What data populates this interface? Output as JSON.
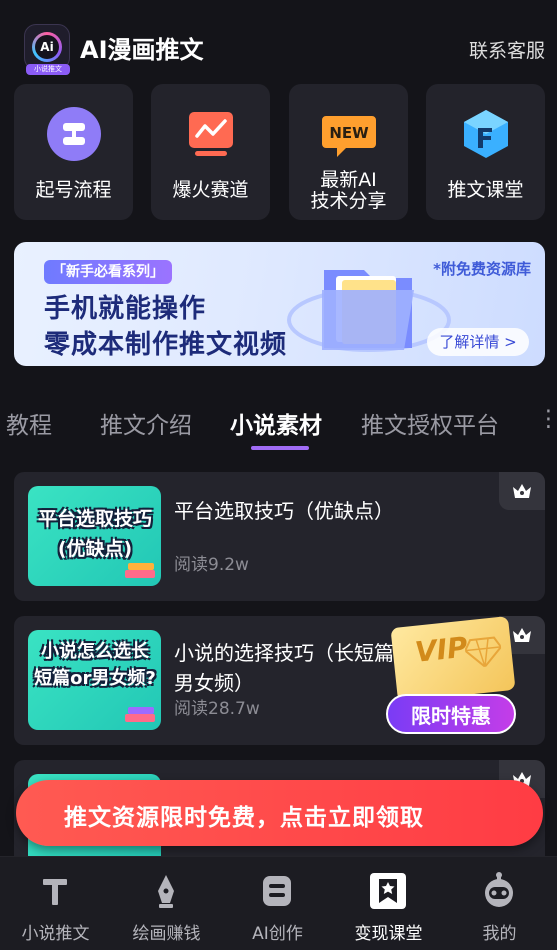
{
  "header": {
    "logo_text": "Ai",
    "logo_tag": "小说推文",
    "app_title": "AI漫画推文",
    "contact_label": "联系客服"
  },
  "tiles": [
    {
      "label": "起号流程",
      "icon": "flow-icon"
    },
    {
      "label": "爆火赛道",
      "icon": "trend-chart-icon"
    },
    {
      "label_line1": "最新AI",
      "label_line2": "技术分享",
      "icon": "new-badge-icon"
    },
    {
      "label": "推文课堂",
      "icon": "classroom-icon"
    }
  ],
  "banner": {
    "badge": "「新手必看系列」",
    "line1": "手机就能操作",
    "line2": "零成本制作推文视频",
    "free_note": "*附免费资源库",
    "more_label": "了解详情 >"
  },
  "tabs": [
    {
      "label": "教程"
    },
    {
      "label": "推文介绍"
    },
    {
      "label": "小说素材",
      "active": true
    },
    {
      "label": "推文授权平台"
    }
  ],
  "cards": [
    {
      "thumb_text": "平台选取技巧(优缺点)",
      "title": "平台选取技巧（优缺点）",
      "reads": "阅读9.2w"
    },
    {
      "thumb_text": "小说怎么选长短篇or男女频?",
      "title": "小说的选择技巧（长短篇男女频）",
      "reads": "阅读28.7w"
    },
    {
      "thumb_text": "",
      "title": "",
      "reads": ""
    }
  ],
  "vip": {
    "card_text": "VIP",
    "button_label": "限时特惠"
  },
  "promo": {
    "text": "推文资源限时免费，点击立即领取"
  },
  "bottom_nav": [
    {
      "label": "小说推文",
      "icon": "text-t-icon"
    },
    {
      "label": "绘画赚钱",
      "icon": "pen-nib-icon"
    },
    {
      "label": "AI创作",
      "icon": "ai-box-icon"
    },
    {
      "label": "变现课堂",
      "icon": "bookmark-star-icon",
      "active": true
    },
    {
      "label": "我的",
      "icon": "robot-avatar-icon"
    }
  ],
  "colors": {
    "background": "#141419",
    "card": "#24242c",
    "accent": "#a06cf5",
    "promo": "#ff4a4a"
  }
}
